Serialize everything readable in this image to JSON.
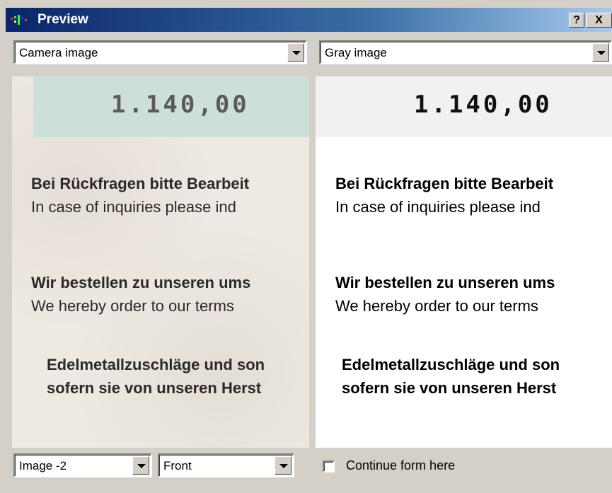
{
  "window": {
    "title": "Preview",
    "help_label": "?",
    "close_label": "X"
  },
  "top_left_combo": {
    "value": "Camera image"
  },
  "top_right_combo": {
    "value": "Gray image"
  },
  "document": {
    "amount": "1.140,00",
    "lines": [
      {
        "text": "Bei Rückfragen bitte Bearbeit",
        "bold": true
      },
      {
        "text": "In case of inquiries please ind",
        "bold": false
      },
      {
        "text": "Wir bestellen zu unseren ums",
        "bold": true
      },
      {
        "text": "We hereby order to our terms",
        "bold": false
      },
      {
        "text": "Edelmetallzuschläge und son",
        "bold": true
      },
      {
        "text": "sofern sie von unseren Herst",
        "bold": true
      }
    ]
  },
  "right_document": {
    "amount": "1.140,00",
    "lines": [
      {
        "text": "Bei Rückfragen bitte Bearbeit",
        "bold": true
      },
      {
        "text": "In case of inquiries please ind",
        "bold": false
      },
      {
        "text": "Wir bestellen zu unseren ums",
        "bold": true
      },
      {
        "text": "We hereby order to our terms",
        "bold": false
      },
      {
        "text": "Edelmetallzuschläge und son",
        "bold": true
      },
      {
        "text": "sofern sie von unseren Herst",
        "bold": true
      }
    ]
  },
  "bottom": {
    "image_select": "Image -2",
    "side_select": "Front",
    "continue_label": "Continue form here",
    "continue_checked": false
  },
  "colors": {
    "titlebar_start": "#0a246a",
    "titlebar_end": "#a6caf0",
    "dialog_bg": "#d4d0c8",
    "camera_band": "#cddfd9"
  }
}
